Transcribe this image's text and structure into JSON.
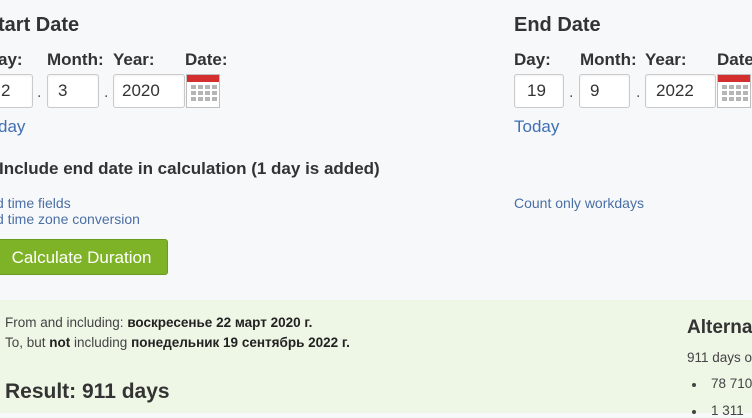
{
  "start": {
    "title": "tart Date",
    "day_label": "ay:",
    "month_label": "Month:",
    "year_label": "Year:",
    "date_label": "Date:",
    "day_value": "2",
    "month_value": "3",
    "year_value": "2020",
    "separator": ".",
    "today_link": "day"
  },
  "end": {
    "title": "End Date",
    "day_label": "Day:",
    "month_label": "Month:",
    "year_label": "Year:",
    "date_label": "Date",
    "day_value": "19",
    "month_value": "9",
    "year_value": "2022",
    "separator": ".",
    "today_link": "Today"
  },
  "options": {
    "include_end": "Include end date in calculation (1 day is added)",
    "time_fields": "d time fields",
    "time_zone": "d time zone conversion",
    "workdays": "Count only workdays"
  },
  "calculate_button": "Calculate Duration",
  "result": {
    "from_prefix": "From and including: ",
    "from_date": "воскресенье 22 март 2020 г.",
    "to_prefix": "To, but ",
    "to_not": "not",
    "to_middle": " including ",
    "to_date": "понедельник 19 сентябрь 2022 г.",
    "result_text": "Result: 911 days"
  },
  "alternative": {
    "title": "Alterna",
    "days_text": "911 days o",
    "items": [
      "78 710",
      "1 311"
    ]
  }
}
